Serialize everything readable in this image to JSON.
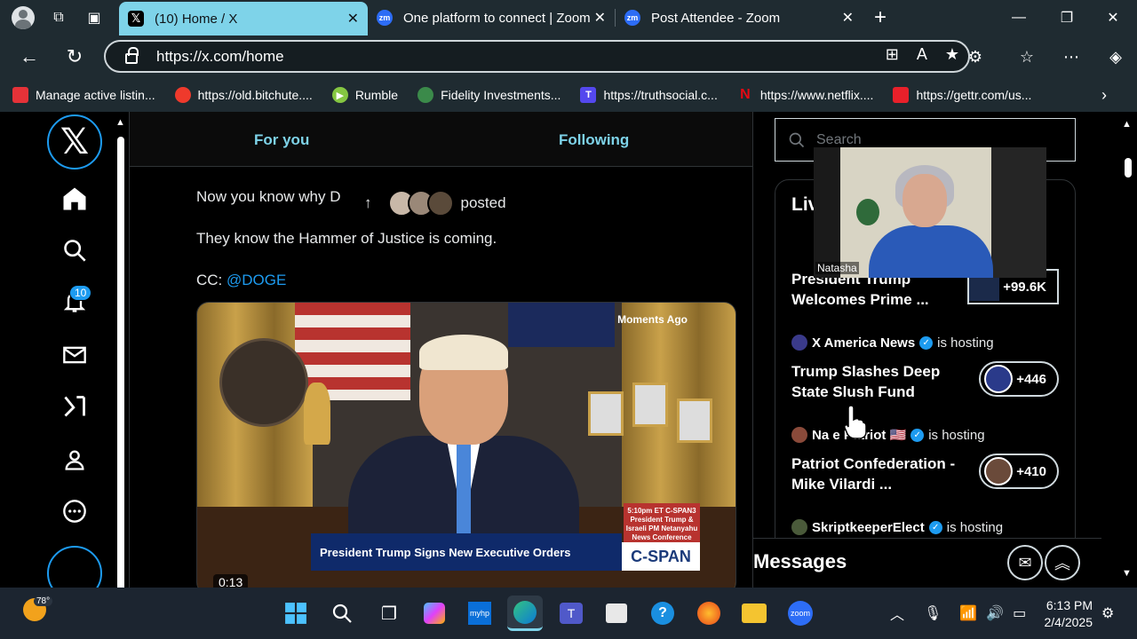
{
  "browser": {
    "tabs": [
      {
        "label": "(10) Home / X",
        "favicon": "X",
        "active": true
      },
      {
        "label": "One platform to connect | Zoom",
        "favicon": "zm",
        "active": false
      },
      {
        "label": "Post Attendee - Zoom",
        "favicon": "zm",
        "active": false
      }
    ],
    "url": "https://x.com/home",
    "bookmarks": [
      {
        "label": "Manage active listin...",
        "color": "#e53238"
      },
      {
        "label": "https://old.bitchute....",
        "color": "#ef3a2c"
      },
      {
        "label": "Rumble",
        "color": "#85c742"
      },
      {
        "label": "Fidelity Investments...",
        "color": "#3b8a4a"
      },
      {
        "label": "https://truthsocial.c...",
        "color": "#5448ee"
      },
      {
        "label": "https://www.netflix....",
        "color": "#e50914"
      },
      {
        "label": "https://gettr.com/us...",
        "color": "#e8202a"
      }
    ]
  },
  "sidebar": {
    "notification_count": "10"
  },
  "feed": {
    "tabs": {
      "for_you": "For you",
      "following": "Following"
    },
    "post_line1": "Now you know why D",
    "reposted_label": "posted",
    "post_line2": "They know the Hammer of Justice is coming.",
    "cc_label": "CC:",
    "mention": "@DOGE",
    "video": {
      "moments_ago": "Moments Ago",
      "news_box": "5:10pm ET C-SPAN3 President Trump & Israeli PM Netanyahu News Conference",
      "lower_third": "President Trump Signs New Executive Orders",
      "network": "C-SPAN",
      "duration": "0:13"
    }
  },
  "right": {
    "search_placeholder": "Search",
    "live_title": "Liv",
    "spaces": [
      {
        "host": "",
        "host_suffix": "",
        "title": "President Trump Welcomes Prime ...",
        "listeners": "+99.6K"
      },
      {
        "host": "X America News",
        "host_suffix": "is hosting",
        "title": "Trump Slashes Deep State Slush Fund",
        "listeners": "+446"
      },
      {
        "host": "Na    e Patriot 🇺🇸",
        "host_suffix": "is hosting",
        "title": "Patriot Confederation - Mike Vilardi ...",
        "listeners": "+410"
      },
      {
        "host": "SkriptkeeperElect",
        "host_suffix": "is hosting",
        "title": "",
        "listeners": ""
      }
    ],
    "messages_title": "Messages"
  },
  "zoom_overlay": {
    "participant_name": "Natasha"
  },
  "taskbar": {
    "temperature": "78°",
    "time": "6:13 PM",
    "date": "2/4/2025"
  }
}
